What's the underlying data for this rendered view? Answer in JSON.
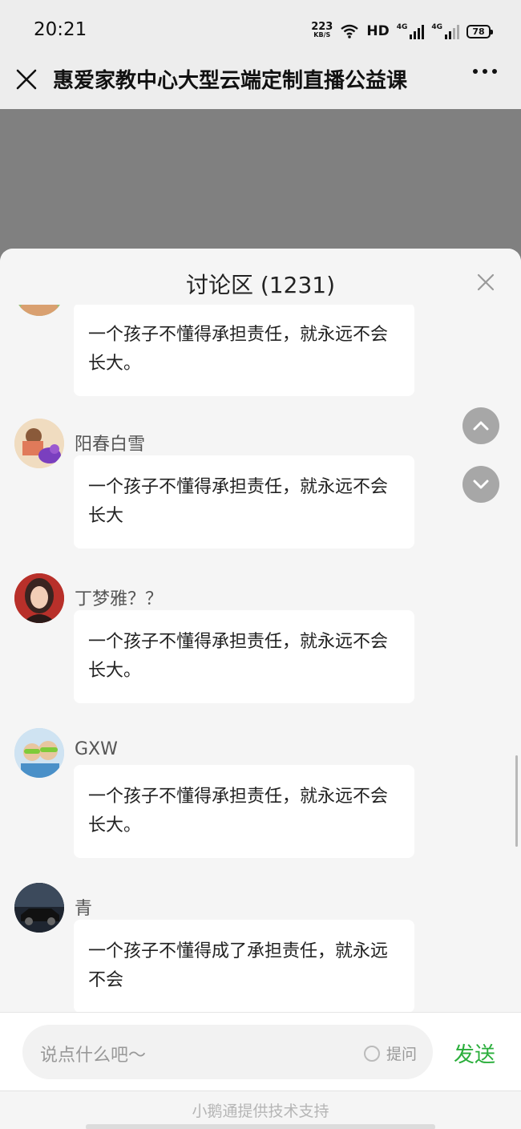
{
  "status_bar": {
    "time": "20:21",
    "net_speed": "223",
    "net_unit": "KB/S",
    "hd_label": "HD",
    "signal1_label": "4G",
    "signal2_label": "4G",
    "battery": "78"
  },
  "nav": {
    "title": "惠爱家教中心大型云端定制直播公益课"
  },
  "discussion": {
    "title": "讨论区 (1231)",
    "messages": [
      {
        "name": "",
        "text": "一个孩子不懂得承担责任，就永远不会长大。",
        "avatar_color": "#9cc07a"
      },
      {
        "name": "阳春白雪",
        "text": "一个孩子不懂得承担责任，就永远不会长大",
        "avatar_color": "#e8b68a"
      },
      {
        "name": " 丁梦雅？？",
        "text": "一个孩子不懂得承担责任，就永远不会长大。",
        "avatar_color": "#8a4a3a"
      },
      {
        "name": "GXW",
        "text": "一个孩子不懂得承担责任，就永远不会长大。",
        "avatar_color": "#a7c8e0"
      },
      {
        "name": "青",
        "text": "一个孩子不懂得成了承担责任，就永远不会",
        "avatar_color": "#2e3440"
      }
    ]
  },
  "input": {
    "placeholder": "说点什么吧～",
    "ask_label": "提问",
    "send_label": "发送"
  },
  "footer": {
    "text": "小鹅通提供技术支持"
  },
  "colors": {
    "accent": "#2aae3b",
    "video_bg": "#808080"
  }
}
